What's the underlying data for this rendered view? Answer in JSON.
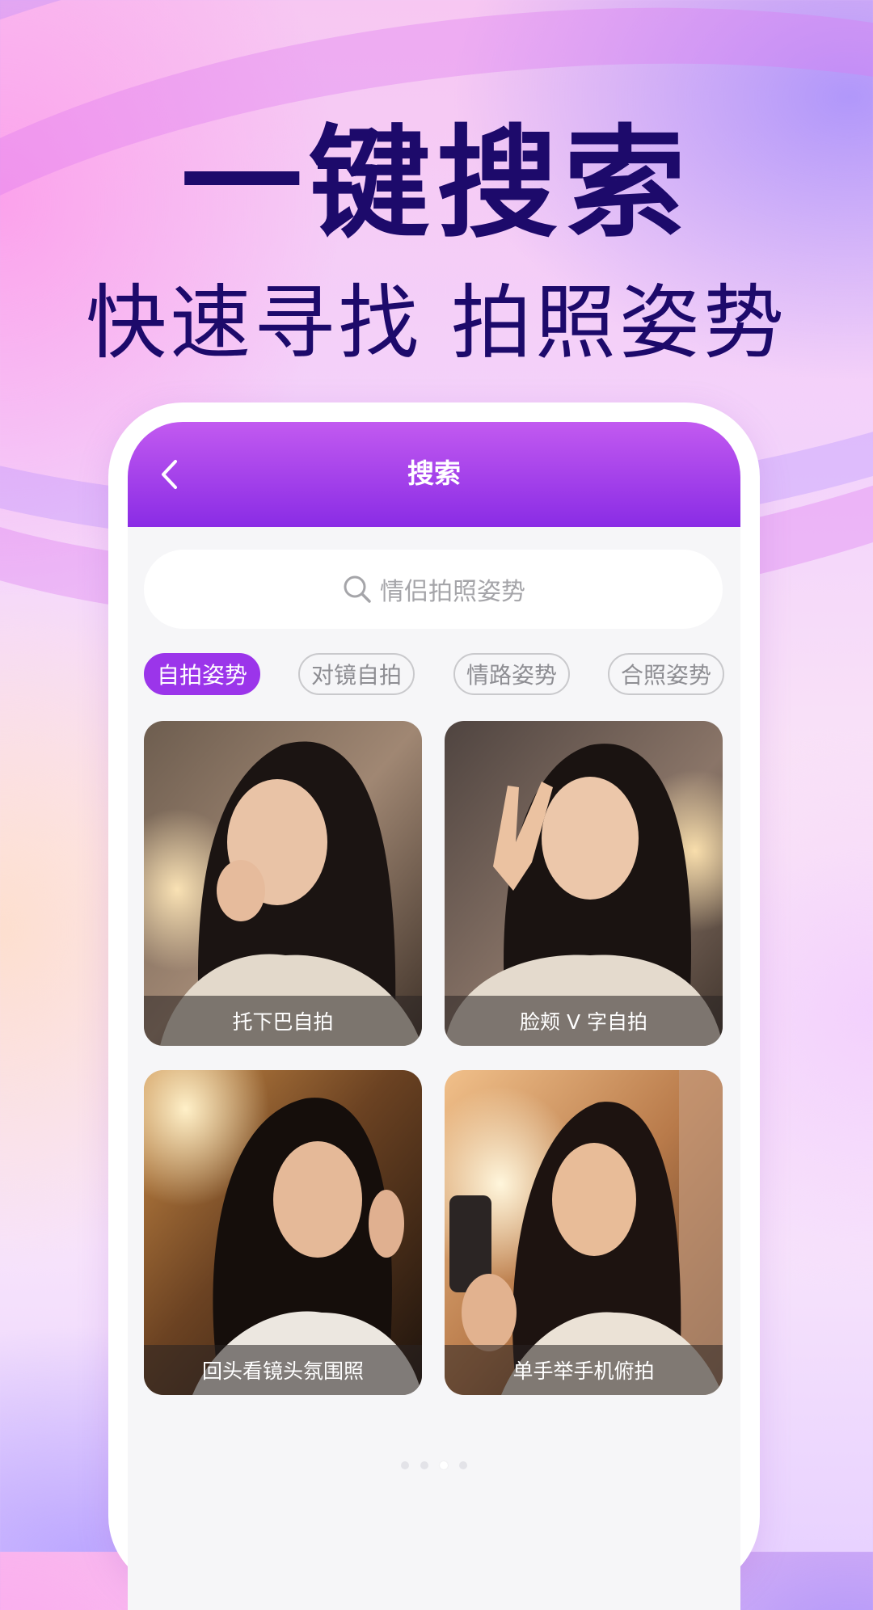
{
  "promo": {
    "headline": "一键搜索",
    "subheadline": "快速寻找 拍照姿势"
  },
  "appbar": {
    "title": "搜索",
    "back_icon": "chevron-left-icon"
  },
  "search": {
    "placeholder": "情侣拍照姿势",
    "icon": "search-icon"
  },
  "categories": [
    {
      "label": "自拍姿势",
      "active": true
    },
    {
      "label": "对镜自拍",
      "active": false
    },
    {
      "label": "情路姿势",
      "active": false
    },
    {
      "label": "合照姿势",
      "active": false
    }
  ],
  "poses": [
    {
      "caption": "托下巴自拍"
    },
    {
      "caption": "脸颊 V 字自拍"
    },
    {
      "caption": "回头看镜头氛围照"
    },
    {
      "caption": "单手举手机俯拍"
    }
  ],
  "pagination": {
    "count": 4,
    "current": 3
  },
  "colors": {
    "headline": "#1d0a6b",
    "appbar_top": "#c25af0",
    "appbar_bottom": "#8a2ce5",
    "chip_active": "#9b35ea"
  }
}
